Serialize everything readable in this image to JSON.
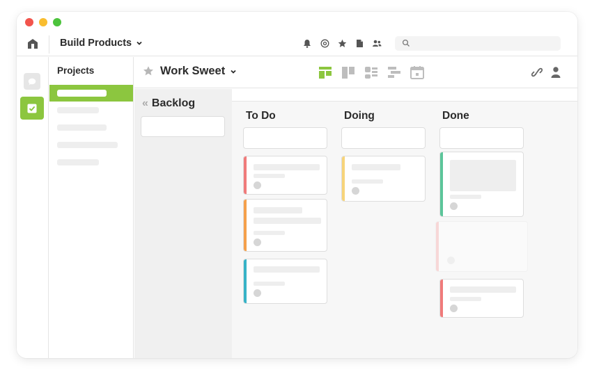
{
  "window": {
    "traffic_lights": [
      {
        "name": "close",
        "color": "#f2544c"
      },
      {
        "name": "minimize",
        "color": "#f9bd2f"
      },
      {
        "name": "zoom",
        "color": "#4cc33c"
      }
    ]
  },
  "topbar": {
    "workspace_label": "Build Products",
    "icons": [
      "bell-icon",
      "at-sign-icon",
      "star-icon",
      "document-icon",
      "people-icon"
    ],
    "search_placeholder": ""
  },
  "sidebar": {
    "items": [
      {
        "name": "chat",
        "icon": "chat-bubble-icon",
        "active": false
      },
      {
        "name": "tasks",
        "icon": "checkbox-icon",
        "active": true
      }
    ]
  },
  "projects": {
    "title": "Projects",
    "items": [
      "",
      "",
      "",
      "",
      ""
    ],
    "active_index": 0
  },
  "board": {
    "title": "Work Sweet",
    "views": [
      "board-view-icon",
      "kanban-view-icon",
      "dashboard-view-icon",
      "gantt-view-icon",
      "calendar-view-icon"
    ],
    "active_view": 0,
    "backlog_label": "Backlog",
    "columns": [
      {
        "title": "To Do",
        "cards": [
          {
            "accent": "#f07b7b"
          },
          {
            "accent": "#f5a04b"
          },
          {
            "accent": "#37b3c7"
          }
        ]
      },
      {
        "title": "Doing",
        "cards": [
          {
            "accent": "#f7d47a"
          }
        ]
      },
      {
        "title": "Done",
        "cards": [
          {
            "accent": "#5cc59a"
          },
          {
            "accent": "#f7b1b1"
          },
          {
            "accent": "#f07b7b"
          }
        ]
      }
    ]
  },
  "colors": {
    "brand_green": "#8cc63f",
    "panel_gray": "#f0f0f0",
    "board_bg": "#f7f7f7",
    "placeholder_gray": "#eeeeee"
  }
}
